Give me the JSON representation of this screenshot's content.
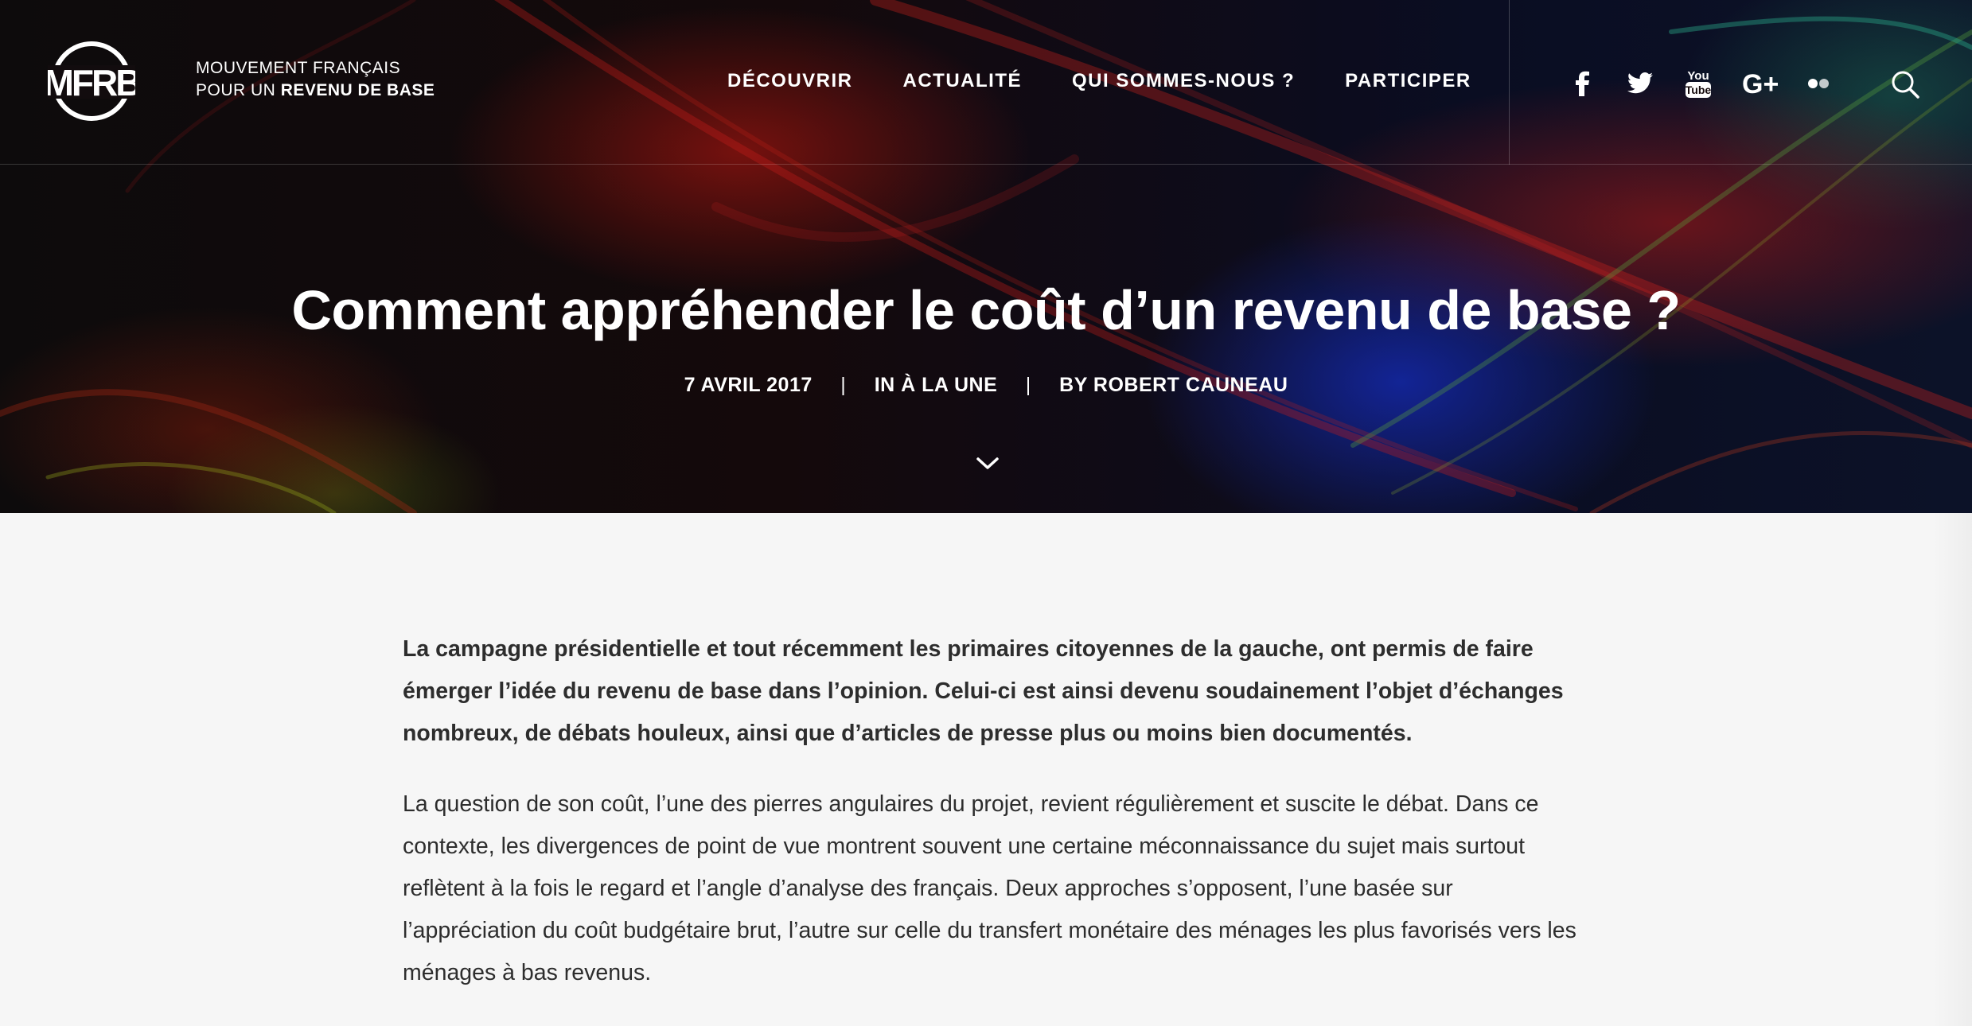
{
  "logo": {
    "line1": "MOUVEMENT FRANÇAIS",
    "line2_prefix": "POUR UN ",
    "line2_bold": "REVENU DE BASE",
    "mark_letters": "MFRB"
  },
  "nav": {
    "items": [
      {
        "label": "DÉCOUVRIR"
      },
      {
        "label": "ACTUALITÉ"
      },
      {
        "label": "QUI SOMMES-NOUS ?"
      },
      {
        "label": "PARTICIPER"
      }
    ]
  },
  "social": {
    "icons": [
      "facebook-icon",
      "twitter-icon",
      "youtube-icon",
      "google-plus-icon",
      "flickr-icon"
    ],
    "google_plus_text": "G+",
    "youtube_text_top": "You",
    "youtube_text_bottom": "Tube"
  },
  "article": {
    "title": "Comment appréhender le coût d’un revenu de base ?",
    "date": "7 AVRIL 2017",
    "category": "IN À LA UNE",
    "author": "BY ROBERT CAUNEAU",
    "separator": "|",
    "lead": "La campagne présidentielle et tout récemment les primaires citoyennes de la gauche, ont permis de faire émerger l’idée du revenu de base dans l’opinion. Celui-ci est ainsi devenu soudainement l’objet d’échanges nombreux, de débats houleux, ainsi que d’articles de presse plus ou moins bien documentés.",
    "paragraph": "La question de son coût, l’une des pierres angulaires du projet, revient régulièrement et suscite le débat. Dans ce contexte, les divergences de point de vue montrent souvent une certaine méconnaissance du sujet mais surtout reflètent à la fois le regard et l’angle d’analyse des français. Deux approches s’opposent, l’une basée sur l’appréciation du coût budgétaire brut, l’autre sur celle du transfert monétaire des ménages les plus favorisés vers les ménages à bas revenus."
  },
  "colors": {
    "hero_dark": "#0d0b0c",
    "accent_red": "#b4191a",
    "accent_blue": "#1428aa",
    "body_bg": "#f6f6f6",
    "text": "#2d2d2d"
  }
}
